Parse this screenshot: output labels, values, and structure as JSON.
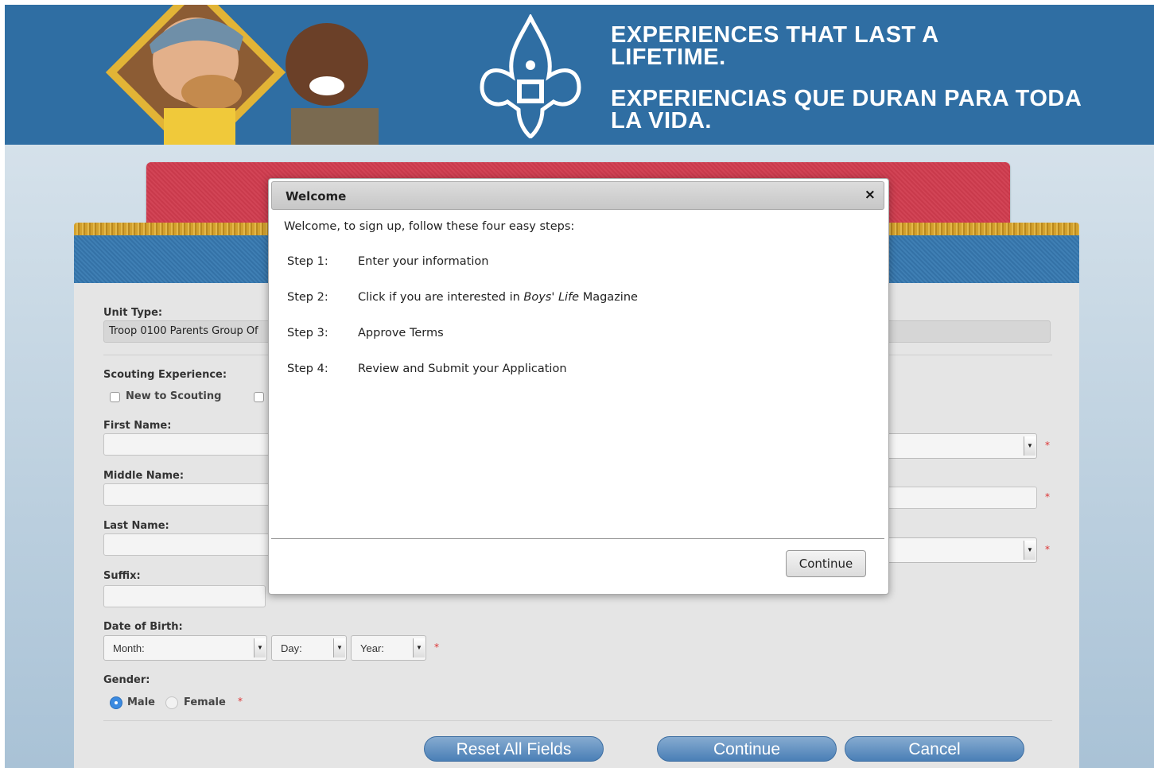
{
  "banner": {
    "slogan_en": "EXPERIENCES THAT LAST A LIFETIME.",
    "slogan_es": "EXPERIENCIAS QUE DURAN PARA TODA LA VIDA."
  },
  "form": {
    "unit_type_label": "Unit Type:",
    "unit_type_value": "Troop 0100 Parents Group Of",
    "scouting_experience_label": "Scouting Experience:",
    "new_to_scouting_label": "New to Scouting",
    "first_name_label": "First Name:",
    "middle_name_label": "Middle Name:",
    "last_name_label": "Last Name:",
    "suffix_label": "Suffix:",
    "dob_label": "Date of Birth:",
    "dob_month": "Month:",
    "dob_day": "Day:",
    "dob_year": "Year:",
    "gender_label": "Gender:",
    "gender_male": "Male",
    "gender_female": "Female",
    "required_mark": "*"
  },
  "buttons": {
    "reset": "Reset All Fields",
    "continue": "Continue",
    "cancel": "Cancel"
  },
  "modal": {
    "title": "Welcome",
    "close": "×",
    "intro": "Welcome, to sign up, follow these four easy steps:",
    "steps": [
      {
        "label": "Step 1:",
        "desc": "Enter your information"
      },
      {
        "label": "Step 2:",
        "desc_before": "Click if you are interested in ",
        "desc_italic": "Boys' Life",
        "desc_after": " Magazine"
      },
      {
        "label": "Step 3:",
        "desc": "Approve Terms"
      },
      {
        "label": "Step 4:",
        "desc": "Review and Submit your Application"
      }
    ],
    "continue": "Continue"
  },
  "colors": {
    "banner_blue": "#2f6ea3",
    "header_red": "#c93a4c",
    "gold": "#d3a12e",
    "button_blue": "#4a7fb6",
    "radio_selected": "#3b8ae0",
    "required_red": "#dd3333"
  },
  "icons": {
    "close": "close-icon",
    "emblem": "scouting-emblem-icon",
    "dropdown": "chevron-down-icon"
  }
}
